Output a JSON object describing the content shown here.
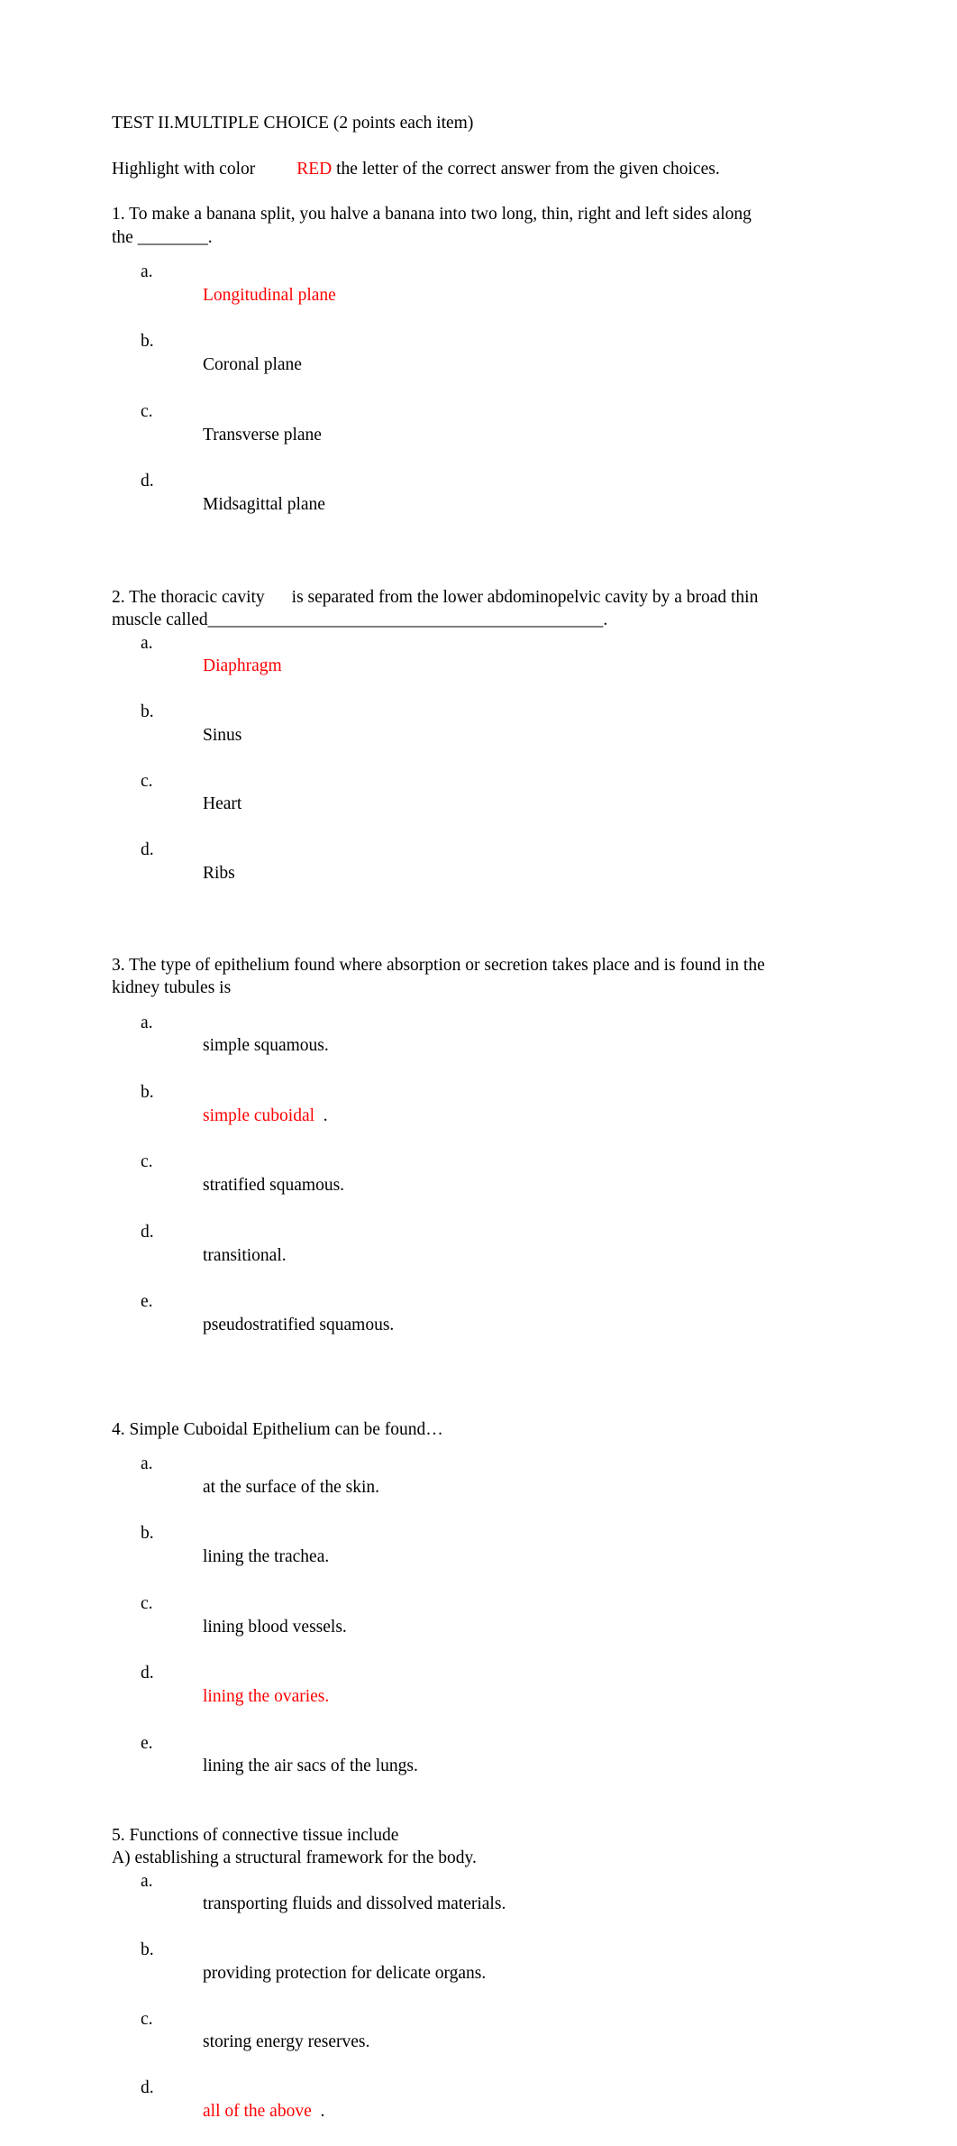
{
  "document": {
    "title_line": "TEST II.MULTIPLE CHOICE (2 points each item)",
    "instruction": {
      "before": "Highlight with color",
      "highlight_word": "RED",
      "after": " the letter of the correct answer from the given choices."
    },
    "accent_color": "#ff0000",
    "text_color": "#000000",
    "questions": [
      {
        "number": "1.",
        "stem": "1. To make a banana split, you halve a banana into two long, thin, right and left sides along the ________.",
        "choices": [
          {
            "marker": "a.",
            "text": "Longitudinal plane",
            "correct": true,
            "trailing": ""
          },
          {
            "marker": "b.",
            "text": "Coronal plane",
            "correct": false,
            "trailing": ""
          },
          {
            "marker": "c.",
            "text": "Transverse plane",
            "correct": false,
            "trailing": ""
          },
          {
            "marker": "d.",
            "text": "Midsagittal plane",
            "correct": false,
            "trailing": ""
          }
        ]
      },
      {
        "number": "2.",
        "stem_part_1": "2. The thoracic cavity",
        "stem_part_2": "is separated from the lower abdominopelvic cavity by a broad thin muscle called",
        "stem_blank": "_____________________________________________",
        "stem_end": ".",
        "choices": [
          {
            "marker": "a.",
            "text": "Diaphragm",
            "correct": true,
            "trailing": ""
          },
          {
            "marker": "b.",
            "text": "Sinus",
            "correct": false,
            "trailing": ""
          },
          {
            "marker": "c.",
            "text": "Heart",
            "correct": false,
            "trailing": ""
          },
          {
            "marker": "d.",
            "text": "Ribs",
            "correct": false,
            "trailing": ""
          }
        ]
      },
      {
        "number": "3.",
        "stem": "3. The type of epithelium found where absorption or secretion takes place and is found in the kidney tubules is",
        "choices": [
          {
            "marker": "a.",
            "text": "simple squamous.",
            "correct": false,
            "trailing": ""
          },
          {
            "marker": "b.",
            "text": "simple cuboidal",
            "correct": true,
            "trailing": "  ."
          },
          {
            "marker": "c.",
            "text": "stratified squamous.",
            "correct": false,
            "trailing": ""
          },
          {
            "marker": "d.",
            "text": "transitional.",
            "correct": false,
            "trailing": ""
          },
          {
            "marker": "e.",
            "text": "pseudostratified squamous.",
            "correct": false,
            "trailing": ""
          }
        ]
      },
      {
        "number": "4.",
        "stem": "4. Simple Cuboidal Epithelium can be found…",
        "choices": [
          {
            "marker": "a.",
            "text": "at the surface of the skin.",
            "correct": false,
            "trailing": ""
          },
          {
            "marker": "b.",
            "text": "lining the trachea.",
            "correct": false,
            "trailing": ""
          },
          {
            "marker": "c.",
            "text": "lining blood vessels.",
            "correct": false,
            "trailing": ""
          },
          {
            "marker": "d.",
            "text": "lining the ovaries.",
            "correct": true,
            "trailing": ""
          },
          {
            "marker": "e.",
            "text": "lining the air sacs of the lungs.",
            "correct": false,
            "trailing": ""
          }
        ]
      },
      {
        "number": "5.",
        "stem": "5. Functions of connective tissue include",
        "sub_line": "A) establishing a structural framework for the body.",
        "choices": [
          {
            "marker": "a.",
            "text": "transporting fluids and dissolved materials.",
            "correct": false,
            "trailing": ""
          },
          {
            "marker": "b.",
            "text": "providing protection for delicate organs.",
            "correct": false,
            "trailing": ""
          },
          {
            "marker": "c.",
            "text": "storing energy reserves.",
            "correct": false,
            "trailing": ""
          },
          {
            "marker": "d.",
            "text": "all of the above",
            "correct": true,
            "trailing": "  ."
          }
        ]
      }
    ]
  }
}
